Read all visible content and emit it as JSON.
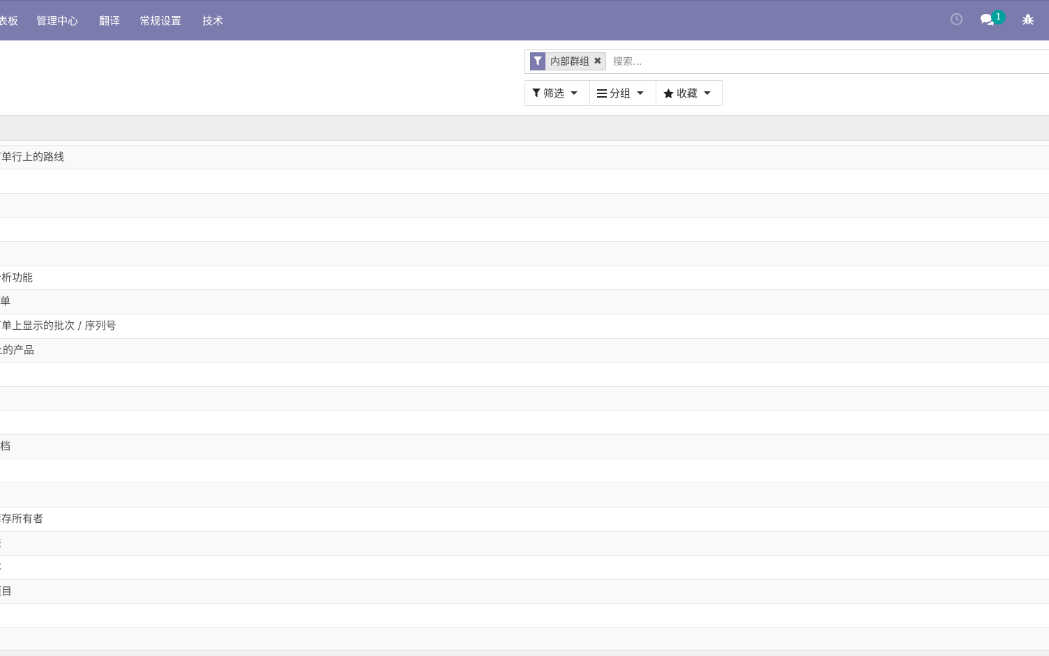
{
  "navbar": {
    "menus": [
      "仪表板",
      "管理中心",
      "翻译",
      "常规设置",
      "技术"
    ],
    "message_count": "1",
    "icons": [
      "clock-icon",
      "chat-icon",
      "bug-icon"
    ],
    "color": "#7c7bad",
    "badge_color": "#00a09d"
  },
  "search": {
    "facet_label": "内部群组",
    "facet_icon": "filter-icon",
    "placeholder": "搜索..."
  },
  "buttons": {
    "filter_label": "筛选",
    "groupby_label": "分组",
    "favorites_label": "收藏"
  },
  "rows": [
    "订单行上的路线",
    "",
    "",
    "",
    "",
    "分析功能",
    "多单",
    "订单上显示的批次 / 序列号",
    "上的产品",
    "",
    "",
    "",
    "文档",
    "",
    "",
    "库存所有者",
    "表",
    "本",
    "项目",
    "",
    ""
  ]
}
